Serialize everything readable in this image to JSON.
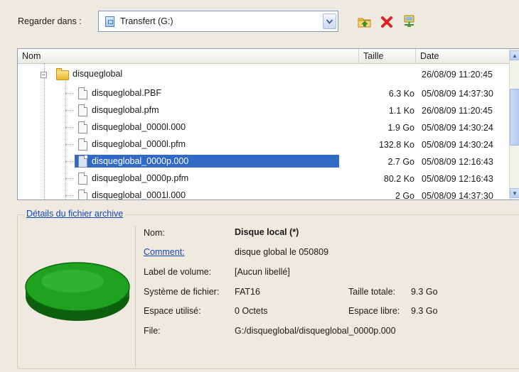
{
  "toolbar": {
    "look_in_label": "Regarder dans :",
    "look_in_value": "Transfert (G:)",
    "icons": [
      "folder-up-icon",
      "delete-icon",
      "network-drive-icon"
    ]
  },
  "list": {
    "columns": [
      "Nom",
      "Taille",
      "Date"
    ],
    "folder": {
      "name": "disqueglobal",
      "date": "26/08/09 11:20:45"
    },
    "files": [
      {
        "name": "disqueglobal.PBF",
        "size": "6.3 Ko",
        "date": "05/08/09 14:37:30"
      },
      {
        "name": "disqueglobal.pfm",
        "size": "1.1 Ko",
        "date": "26/08/09 11:20:45"
      },
      {
        "name": "disqueglobal_0000l.000",
        "size": "1.9 Go",
        "date": "05/08/09 14:30:24"
      },
      {
        "name": "disqueglobal_0000l.pfm",
        "size": "132.8 Ko",
        "date": "05/08/09 14:30:24"
      },
      {
        "name": "disqueglobal_0000p.000",
        "size": "2.7 Go",
        "date": "05/08/09 12:16:43",
        "selected": true
      },
      {
        "name": "disqueglobal_0000p.pfm",
        "size": "80.2 Ko",
        "date": "05/08/09 12:16:43"
      },
      {
        "name": "disqueglobal_0001l.000",
        "size": "2 Go",
        "date": "05/08/09 14:37:30"
      }
    ]
  },
  "details": {
    "title": "Détails du fichier archive",
    "name_label": "Nom:",
    "name_value": "Disque local (*)",
    "comment_label": "Comment:",
    "comment_value": "disque global le 050809",
    "volume_label": "Label de volume:",
    "volume_value": "[Aucun libellé]",
    "fs_label": "Système de fichier:",
    "fs_value": "FAT16",
    "total_label": "Taille totale:",
    "total_value": "9.3 Go",
    "used_label": "Espace utilisé:",
    "used_value": "0 Octets",
    "free_label": "Espace libre:",
    "free_value": "9.3 Go",
    "file_label": "File:",
    "file_value": "G:/disqueglobal/disqueglobal_0000p.000",
    "disk_color": "#1fa21f"
  }
}
